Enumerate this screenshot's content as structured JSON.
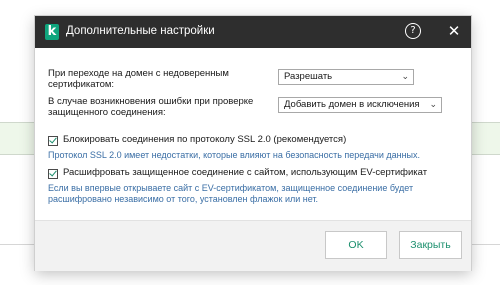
{
  "window": {
    "title": "Дополнительные настройки",
    "logo_letter": "k",
    "help_glyph": "?",
    "close_glyph": "✕",
    "icons": [
      "kaspersky-logo-icon",
      "help-icon",
      "close-icon"
    ]
  },
  "settings": {
    "untrusted_domain": {
      "label": "При переходе на домен с недоверенным сертификатом:",
      "value": "Разрешать"
    },
    "error_handling": {
      "label": "В случае возникновения ошибки при проверке защищенного соединения:",
      "value": "Добавить домен в исключения"
    },
    "block_ssl2": {
      "checked": true,
      "label": "Блокировать соединения по протоколу SSL 2.0 (рекомендуется)",
      "hint": "Протокол SSL 2.0 имеет недостатки, которые влияют на безопасность передачи данных."
    },
    "decrypt_ev": {
      "checked": true,
      "label": "Расшифровать защищенное соединение с сайтом, использующим EV-сертификат",
      "hint": "Если вы впервые открываете сайт с EV-сертификатом, защищенное соединение будет расшифровано независимо от того, установлен флажок или нет."
    }
  },
  "footer": {
    "ok_label": "OK",
    "close_label": "Закрыть"
  },
  "colors": {
    "titlebar": "#2e2e2e",
    "accent": "#1b8f6d",
    "hint_text": "#3a6ea5",
    "logo": "#0fa57d"
  }
}
